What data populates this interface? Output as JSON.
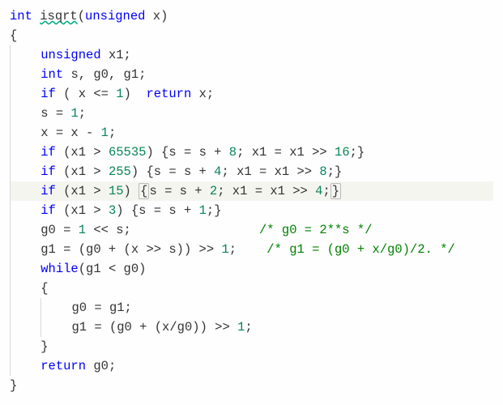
{
  "code": {
    "lines": [
      {
        "id": 0,
        "highlighted": false,
        "tokens": [
          {
            "t": "int ",
            "c": "kw"
          },
          {
            "t": "isqrt",
            "c": "fn"
          },
          {
            "t": "(",
            "c": "op"
          },
          {
            "t": "unsigned ",
            "c": "kw"
          },
          {
            "t": "x)",
            "c": "txt"
          }
        ]
      },
      {
        "id": 1,
        "highlighted": false,
        "tokens": [
          {
            "t": "{",
            "c": "op"
          }
        ]
      },
      {
        "id": 2,
        "highlighted": false,
        "indent": 1,
        "tokens": [
          {
            "t": "unsigned ",
            "c": "kw"
          },
          {
            "t": "x1;",
            "c": "txt"
          }
        ]
      },
      {
        "id": 3,
        "highlighted": false,
        "indent": 1,
        "tokens": [
          {
            "t": "int ",
            "c": "kw"
          },
          {
            "t": "s, g0, g1;",
            "c": "txt"
          }
        ]
      },
      {
        "id": 4,
        "highlighted": false,
        "indent": 1,
        "tokens": [
          {
            "t": "if ",
            "c": "kw"
          },
          {
            "t": "( x <= ",
            "c": "txt"
          },
          {
            "t": "1",
            "c": "num"
          },
          {
            "t": ")  ",
            "c": "txt"
          },
          {
            "t": "return ",
            "c": "kw"
          },
          {
            "t": "x;",
            "c": "txt"
          }
        ]
      },
      {
        "id": 5,
        "highlighted": false,
        "indent": 1,
        "tokens": [
          {
            "t": "s = ",
            "c": "txt"
          },
          {
            "t": "1",
            "c": "num"
          },
          {
            "t": ";",
            "c": "txt"
          }
        ]
      },
      {
        "id": 6,
        "highlighted": false,
        "indent": 1,
        "tokens": [
          {
            "t": "x = x - ",
            "c": "txt"
          },
          {
            "t": "1",
            "c": "num"
          },
          {
            "t": ";",
            "c": "txt"
          }
        ]
      },
      {
        "id": 7,
        "highlighted": false,
        "indent": 1,
        "tokens": [
          {
            "t": "if ",
            "c": "kw"
          },
          {
            "t": "(x1 > ",
            "c": "txt"
          },
          {
            "t": "65535",
            "c": "num"
          },
          {
            "t": ") {s = s + ",
            "c": "txt"
          },
          {
            "t": "8",
            "c": "num"
          },
          {
            "t": "; x1 = x1 >> ",
            "c": "txt"
          },
          {
            "t": "16",
            "c": "num"
          },
          {
            "t": ";}",
            "c": "txt"
          }
        ]
      },
      {
        "id": 8,
        "highlighted": false,
        "indent": 1,
        "tokens": [
          {
            "t": "if ",
            "c": "kw"
          },
          {
            "t": "(x1 > ",
            "c": "txt"
          },
          {
            "t": "255",
            "c": "num"
          },
          {
            "t": ") {s = s + ",
            "c": "txt"
          },
          {
            "t": "4",
            "c": "num"
          },
          {
            "t": "; x1 = x1 >> ",
            "c": "txt"
          },
          {
            "t": "8",
            "c": "num"
          },
          {
            "t": ";}",
            "c": "txt"
          }
        ]
      },
      {
        "id": 9,
        "highlighted": true,
        "indent": 1,
        "tokens": [
          {
            "t": "if ",
            "c": "kw"
          },
          {
            "t": "(x1 > ",
            "c": "txt"
          },
          {
            "t": "15",
            "c": "num"
          },
          {
            "t": ") ",
            "c": "txt"
          },
          {
            "t": "{",
            "c": "box"
          },
          {
            "t": "s = s + ",
            "c": "txt"
          },
          {
            "t": "2",
            "c": "num"
          },
          {
            "t": "; x1 = x1 >> ",
            "c": "txt"
          },
          {
            "t": "4",
            "c": "num"
          },
          {
            "t": ";",
            "c": "txt"
          },
          {
            "t": "}",
            "c": "box"
          }
        ]
      },
      {
        "id": 10,
        "highlighted": false,
        "indent": 1,
        "tokens": [
          {
            "t": "if ",
            "c": "kw"
          },
          {
            "t": "(x1 > ",
            "c": "txt"
          },
          {
            "t": "3",
            "c": "num"
          },
          {
            "t": ") {s = s + ",
            "c": "txt"
          },
          {
            "t": "1",
            "c": "num"
          },
          {
            "t": ";}",
            "c": "txt"
          }
        ]
      },
      {
        "id": 11,
        "highlighted": false,
        "indent": 1,
        "tokens": [
          {
            "t": "g0 = ",
            "c": "txt"
          },
          {
            "t": "1",
            "c": "num"
          },
          {
            "t": " << s;                 ",
            "c": "txt"
          },
          {
            "t": "/* g0 = 2**s */",
            "c": "cmt"
          }
        ]
      },
      {
        "id": 12,
        "highlighted": false,
        "indent": 1,
        "tokens": [
          {
            "t": "g1 = (g0 + (x >> s)) >> ",
            "c": "txt"
          },
          {
            "t": "1",
            "c": "num"
          },
          {
            "t": ";    ",
            "c": "txt"
          },
          {
            "t": "/* g1 = (g0 + x/g0)/2. */",
            "c": "cmt"
          }
        ]
      },
      {
        "id": 13,
        "highlighted": false,
        "indent": 1,
        "tokens": [
          {
            "t": "while",
            "c": "kw"
          },
          {
            "t": "(g1 < g0)",
            "c": "txt"
          }
        ]
      },
      {
        "id": 14,
        "highlighted": false,
        "indent": 1,
        "tokens": [
          {
            "t": "{",
            "c": "op"
          }
        ]
      },
      {
        "id": 15,
        "highlighted": false,
        "indent": 2,
        "tokens": [
          {
            "t": "g0 = g1;",
            "c": "txt"
          }
        ]
      },
      {
        "id": 16,
        "highlighted": false,
        "indent": 2,
        "tokens": [
          {
            "t": "g1 = (g0 + (x/g0)) >> ",
            "c": "txt"
          },
          {
            "t": "1",
            "c": "num"
          },
          {
            "t": ";",
            "c": "txt"
          }
        ]
      },
      {
        "id": 17,
        "highlighted": false,
        "indent": 1,
        "tokens": [
          {
            "t": "}",
            "c": "op"
          }
        ]
      },
      {
        "id": 18,
        "highlighted": false,
        "indent": 1,
        "tokens": [
          {
            "t": "return ",
            "c": "kw"
          },
          {
            "t": "g0;",
            "c": "txt"
          }
        ]
      },
      {
        "id": 19,
        "highlighted": false,
        "tokens": [
          {
            "t": "}",
            "c": "op"
          }
        ]
      }
    ]
  }
}
